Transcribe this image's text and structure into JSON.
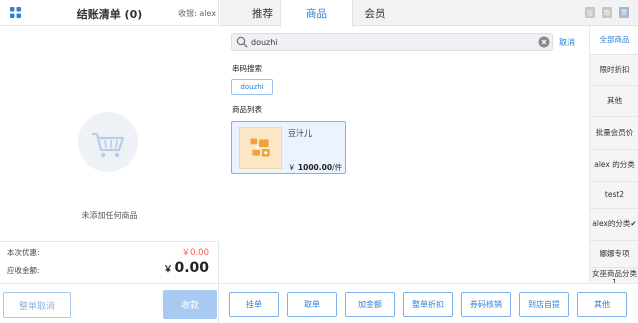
{
  "cart": {
    "title": "结账清单 (0)",
    "cashier": "收银: alex",
    "empty_text": "未添加任何商品",
    "discount_label": "本次优惠:",
    "discount_value": "￥0.00",
    "receivable_label": "应收金额:",
    "receivable_currency": "￥",
    "receivable_value": "0.00",
    "cancel_label": "整单取消",
    "checkout_label": "收款"
  },
  "tabs": [
    {
      "label": "推荐",
      "active": false
    },
    {
      "label": "商品",
      "active": true
    },
    {
      "label": "会员",
      "active": false
    }
  ],
  "corner_buttons": [
    "挂",
    "取",
    "票"
  ],
  "search": {
    "value": "douzhi",
    "cancel_label": "取消"
  },
  "serial_search": {
    "title": "串码搜索",
    "chip": "douzhi"
  },
  "product_list": {
    "title": "商品列表",
    "items": [
      {
        "name": "豆汁儿",
        "currency": "￥",
        "price": "1000.00",
        "unit": "/件"
      }
    ]
  },
  "categories": [
    {
      "label": "全部商品",
      "active": true
    },
    {
      "label": "限时折扣",
      "active": false
    },
    {
      "label": "其他",
      "active": false
    },
    {
      "label": "批量会员价",
      "active": false
    },
    {
      "label": "alex 的分类",
      "active": false
    },
    {
      "label": "test2",
      "active": false
    },
    {
      "label": "alex的分类✔",
      "active": false
    },
    {
      "label": "娜娜专项",
      "active": false
    },
    {
      "label": "女巫商品分类1",
      "active": false
    }
  ],
  "actions": [
    "挂单",
    "取单",
    "加金额",
    "整单折扣",
    "券码核销",
    "到店自提",
    "其他"
  ],
  "colors": {
    "accent": "#2f7fd6",
    "discount_red": "#ff5a5a",
    "checkout_bg": "#a7c9f2",
    "card_bg": "#eaf3ff"
  }
}
